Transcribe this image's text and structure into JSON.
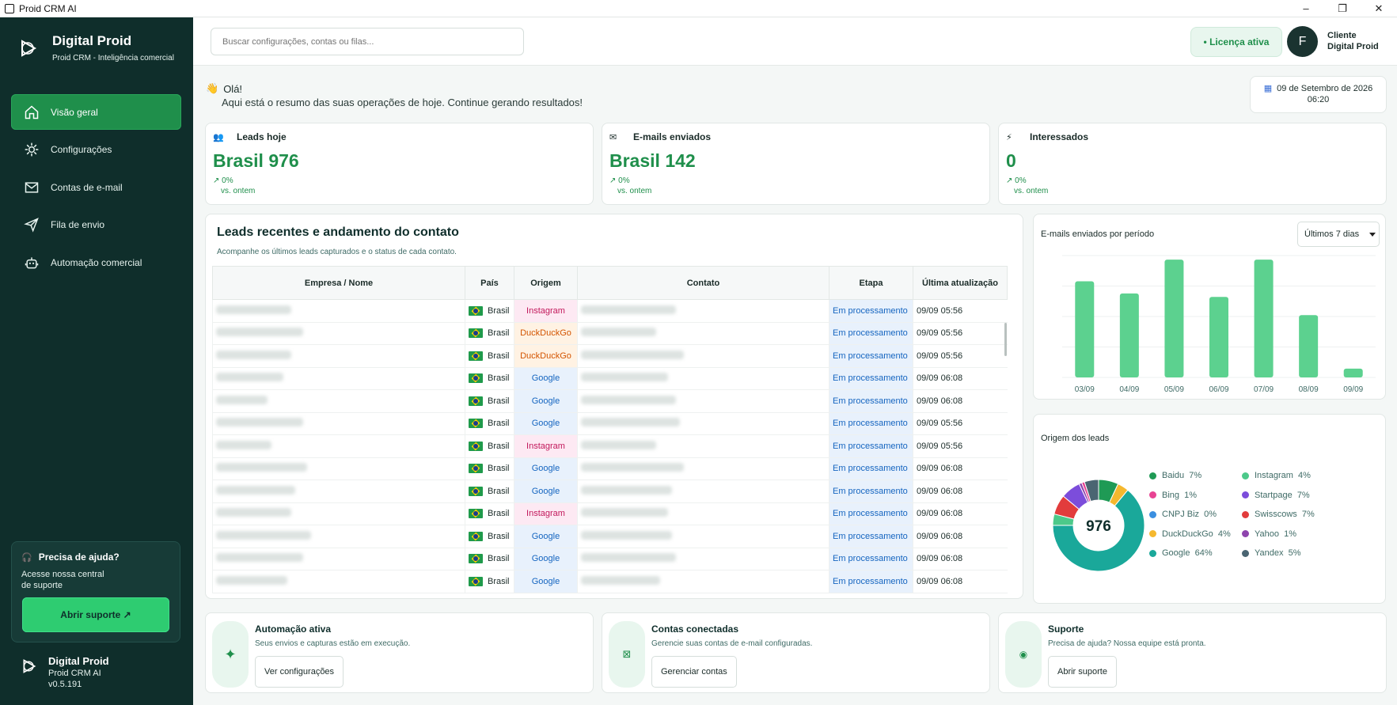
{
  "window": {
    "title": "Proid CRM AI"
  },
  "sidebar": {
    "brand_title": "Digital Proid",
    "brand_subtitle": "Proid CRM - Inteligência comercial",
    "items": [
      {
        "label": "Visão geral",
        "icon": "home-icon"
      },
      {
        "label": "Configurações",
        "icon": "gear-icon"
      },
      {
        "label": "Contas de e-mail",
        "icon": "mail-icon"
      },
      {
        "label": "Fila de envio",
        "icon": "send-icon"
      },
      {
        "label": "Automação comercial",
        "icon": "robot-icon"
      }
    ],
    "help_title": "Precisa de ajuda?",
    "help_text": "Acesse nossa central de suporte",
    "help_button": "Abrir suporte ↗",
    "footer_title": "Digital Proid",
    "footer_app": "Proid CRM AI",
    "footer_version": "v0.5.191"
  },
  "topbar": {
    "search_placeholder": "Buscar configurações, contas ou filas...",
    "license": "• Licença ativa",
    "avatar_initial": "F",
    "user_line1": "Cliente",
    "user_line2": "Digital Proid"
  },
  "greeting": {
    "hello": "Olá!",
    "text": "Aqui está o resumo das suas operações de hoje. Continue gerando resultados!",
    "date": "09 de Setembro de 2026",
    "time": "06:20"
  },
  "stats": [
    {
      "label": "Leads hoje",
      "value": "Brasil 976",
      "delta": "↗ 0%",
      "vs": "vs. ontem",
      "icon": "users-icon"
    },
    {
      "label": "E-mails enviados",
      "value": "Brasil 142",
      "delta": "↗ 0%",
      "vs": "vs. ontem",
      "icon": "mail-icon"
    },
    {
      "label": "Interessados",
      "value": "0",
      "delta": "↗ 0%",
      "vs": "vs. ontem",
      "icon": "bolt-icon"
    }
  ],
  "leads": {
    "title": "Leads recentes e andamento do contato",
    "subtitle": "Acompanhe os últimos leads capturados e o status de cada contato.",
    "columns": [
      "Empresa / Nome",
      "País",
      "Origem",
      "Contato",
      "Etapa",
      "Última atualização"
    ],
    "rows": [
      {
        "country": "Brasil",
        "origin": "Instagram",
        "stage": "Em processamento",
        "updated": "09/09 05:56"
      },
      {
        "country": "Brasil",
        "origin": "DuckDuckGo",
        "stage": "Em processamento",
        "updated": "09/09 05:56"
      },
      {
        "country": "Brasil",
        "origin": "DuckDuckGo",
        "stage": "Em processamento",
        "updated": "09/09 05:56"
      },
      {
        "country": "Brasil",
        "origin": "Google",
        "stage": "Em processamento",
        "updated": "09/09 06:08"
      },
      {
        "country": "Brasil",
        "origin": "Google",
        "stage": "Em processamento",
        "updated": "09/09 06:08"
      },
      {
        "country": "Brasil",
        "origin": "Google",
        "stage": "Em processamento",
        "updated": "09/09 05:56"
      },
      {
        "country": "Brasil",
        "origin": "Instagram",
        "stage": "Em processamento",
        "updated": "09/09 05:56"
      },
      {
        "country": "Brasil",
        "origin": "Google",
        "stage": "Em processamento",
        "updated": "09/09 06:08"
      },
      {
        "country": "Brasil",
        "origin": "Google",
        "stage": "Em processamento",
        "updated": "09/09 06:08"
      },
      {
        "country": "Brasil",
        "origin": "Instagram",
        "stage": "Em processamento",
        "updated": "09/09 06:08"
      },
      {
        "country": "Brasil",
        "origin": "Google",
        "stage": "Em processamento",
        "updated": "09/09 06:08"
      },
      {
        "country": "Brasil",
        "origin": "Google",
        "stage": "Em processamento",
        "updated": "09/09 06:08"
      },
      {
        "country": "Brasil",
        "origin": "Google",
        "stage": "Em processamento",
        "updated": "09/09 06:08"
      }
    ]
  },
  "period_select": "Últimos 7 dias",
  "chart_data": [
    {
      "type": "bar",
      "title": "E-mails enviados por período",
      "categories": [
        "03/09",
        "04/09",
        "05/09",
        "06/09",
        "07/09",
        "08/09",
        "09/09"
      ],
      "values": [
        142,
        124,
        174,
        119,
        174,
        92,
        13
      ],
      "ylim": [
        0,
        180
      ],
      "grid": true,
      "color": "#5cd18f"
    },
    {
      "type": "pie",
      "title": "Origem dos leads",
      "center_label": "976",
      "series": [
        {
          "name": "Baidu",
          "value": 7,
          "label": "7%",
          "color": "#1f9a55"
        },
        {
          "name": "Instagram",
          "value": 4,
          "label": "4%",
          "color": "#4cc98a"
        },
        {
          "name": "Bing",
          "value": 1,
          "label": "1%",
          "color": "#e84393"
        },
        {
          "name": "Startpage",
          "value": 7,
          "label": "7%",
          "color": "#7c4ddb"
        },
        {
          "name": "CNPJ Biz",
          "value": 0,
          "label": "0%",
          "color": "#3b8fe0"
        },
        {
          "name": "Swisscows",
          "value": 7,
          "label": "7%",
          "color": "#e23c3c"
        },
        {
          "name": "DuckDuckGo",
          "value": 4,
          "label": "4%",
          "color": "#f5b82e"
        },
        {
          "name": "Yahoo",
          "value": 1,
          "label": "1%",
          "color": "#8e44ad"
        },
        {
          "name": "Google",
          "value": 64,
          "label": "64%",
          "color": "#1aa89a"
        },
        {
          "name": "Yandex",
          "value": 5,
          "label": "5%",
          "color": "#4a6572"
        }
      ]
    }
  ],
  "bottom_cards": [
    {
      "title": "Automação ativa",
      "text": "Seus envios e capturas estão em execução.",
      "button": "Ver configurações",
      "icon": "sparkle-icon"
    },
    {
      "title": "Contas conectadas",
      "text": "Gerencie suas contas de e-mail configuradas.",
      "button": "Gerenciar contas",
      "icon": "accounts-icon"
    },
    {
      "title": "Suporte",
      "text": "Precisa de ajuda? Nossa equipe está pronta.",
      "button": "Abrir suporte",
      "icon": "support-icon"
    }
  ]
}
